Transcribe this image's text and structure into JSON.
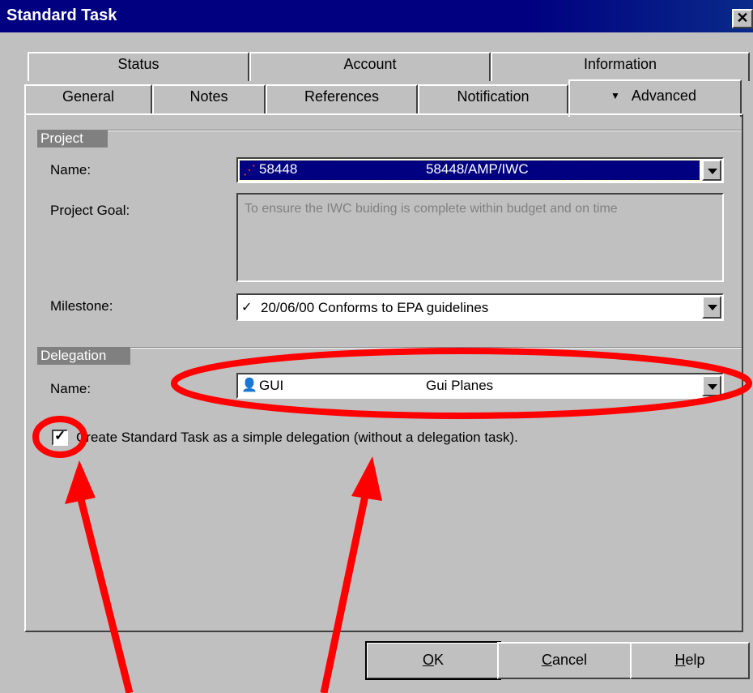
{
  "window": {
    "title": "Standard Task",
    "close_glyph": "✕"
  },
  "tabs_back": [
    {
      "label": "Status"
    },
    {
      "label": "Account"
    },
    {
      "label": "Information"
    }
  ],
  "tabs_front": [
    {
      "label": "General"
    },
    {
      "label": "Notes"
    },
    {
      "label": "References"
    },
    {
      "label": "Notification"
    },
    {
      "label": "Advanced",
      "active": true
    }
  ],
  "project": {
    "section_label": "Project",
    "name_label": "Name:",
    "name_code": "58448",
    "name_value": "58448/AMP/IWC",
    "goal_label": "Project Goal:",
    "goal_text": "To ensure the IWC buiding is complete within budget and on time",
    "milestone_label": "Milestone:",
    "milestone_value": "20/06/00 Conforms to EPA guidelines"
  },
  "delegation": {
    "section_label": "Delegation",
    "name_label": "Name:",
    "name_code": "GUI",
    "name_value": "Gui Planes",
    "checkbox_checked": true,
    "checkbox_label": "Create Standard Task as a simple delegation (without a delegation task)."
  },
  "buttons": {
    "ok": {
      "mnemonic": "O",
      "rest": "K"
    },
    "cancel": {
      "mnemonic": "C",
      "rest": "ancel"
    },
    "help": {
      "mnemonic": "H",
      "rest": "elp"
    }
  },
  "annotations": {
    "color": "#ff0000"
  }
}
